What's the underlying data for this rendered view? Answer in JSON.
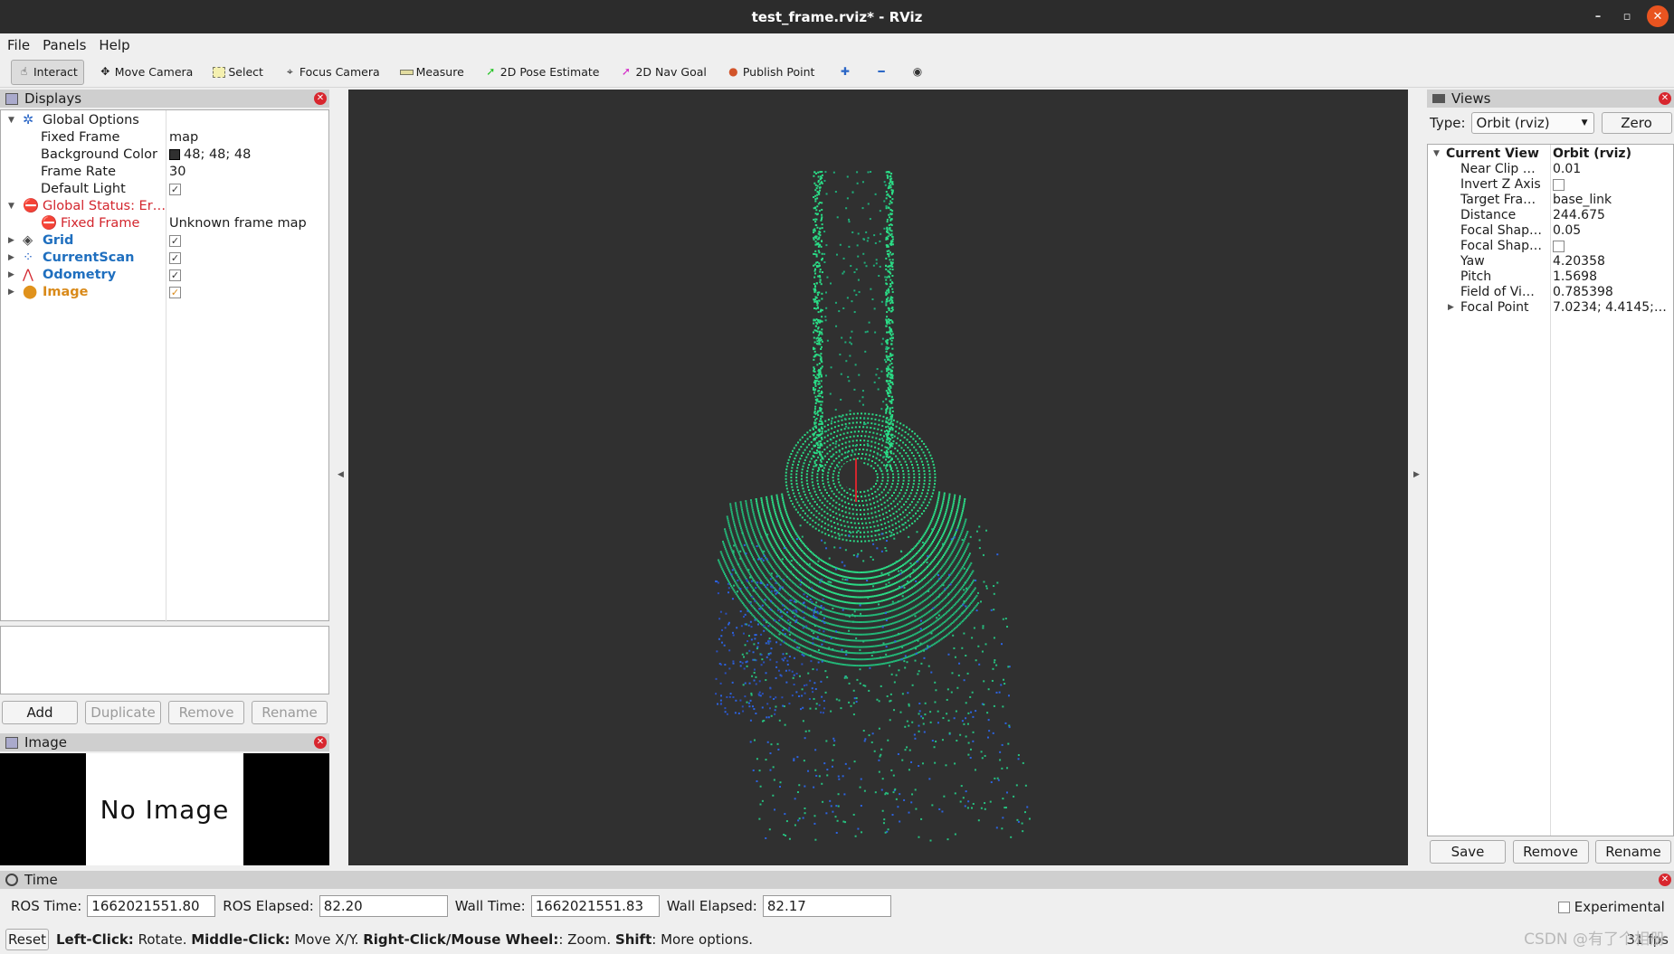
{
  "window": {
    "title": "test_frame.rviz* - RViz",
    "btn_min": "–",
    "btn_max": "▫",
    "btn_close": "✕"
  },
  "menu": [
    "File",
    "Panels",
    "Help"
  ],
  "toolbar": [
    {
      "label": "Interact",
      "icon": "hand-icon"
    },
    {
      "label": "Move Camera",
      "icon": "move-camera-icon"
    },
    {
      "label": "Select",
      "icon": "select-icon"
    },
    {
      "label": "Focus Camera",
      "icon": "focus-camera-icon"
    },
    {
      "label": "Measure",
      "icon": "measure-icon"
    },
    {
      "label": "2D Pose Estimate",
      "icon": "pose-arrow-icon"
    },
    {
      "label": "2D Nav Goal",
      "icon": "nav-goal-arrow-icon"
    },
    {
      "label": "Publish Point",
      "icon": "map-pin-icon"
    }
  ],
  "displays": {
    "title": "Displays",
    "global_options": "Global Options",
    "fixed_frame_label": "Fixed Frame",
    "fixed_frame_value": "map",
    "bg_color_label": "Background Color",
    "bg_color_value": "48; 48; 48",
    "bg_color_swatch": "#303030",
    "frame_rate_label": "Frame Rate",
    "frame_rate_value": "30",
    "default_light_label": "Default Light",
    "global_status": "Global Status: Er…",
    "status_fixed_frame": "Fixed Frame",
    "status_fixed_frame_value": "Unknown frame map",
    "grid": "Grid",
    "current_scan": "CurrentScan",
    "odometry": "Odometry",
    "image": "Image",
    "check": "✓"
  },
  "display_buttons": {
    "add": "Add",
    "duplicate": "Duplicate",
    "remove": "Remove",
    "rename": "Rename"
  },
  "image_panel": {
    "title": "Image",
    "no_image": "No Image"
  },
  "views": {
    "title": "Views",
    "type_label": "Type:",
    "type_value": "Orbit (rviz)",
    "zero": "Zero",
    "current_view": "Current View",
    "current_view_value": "Orbit (rviz)",
    "props": [
      {
        "k": "Near Clip …",
        "v": "0.01"
      },
      {
        "k": "Invert Z Axis",
        "v": ""
      },
      {
        "k": "Target Fra…",
        "v": "base_link"
      },
      {
        "k": "Distance",
        "v": "244.675"
      },
      {
        "k": "Focal Shap…",
        "v": "0.05"
      },
      {
        "k": "Focal Shap…",
        "v": ""
      },
      {
        "k": "Yaw",
        "v": "4.20358"
      },
      {
        "k": "Pitch",
        "v": "1.5698"
      },
      {
        "k": "Field of Vi…",
        "v": "0.785398"
      },
      {
        "k": "Focal Point",
        "v": "7.0234; 4.4145; -…"
      }
    ],
    "save": "Save",
    "remove": "Remove",
    "rename": "Rename"
  },
  "time": {
    "title": "Time",
    "ros_time_label": "ROS Time:",
    "ros_time": "1662021551.80",
    "ros_elapsed_label": "ROS Elapsed:",
    "ros_elapsed": "82.20",
    "wall_time_label": "Wall Time:",
    "wall_time": "1662021551.83",
    "wall_elapsed_label": "Wall Elapsed:",
    "wall_elapsed": "82.17",
    "experimental": "Experimental",
    "reset": "Reset",
    "hint_left": "Left-Click:",
    "hint_left_t": " Rotate. ",
    "hint_middle": "Middle-Click:",
    "hint_middle_t": " Move X/Y. ",
    "hint_right": "Right-Click/Mouse Wheel:",
    "hint_right_t": ": Zoom. ",
    "hint_shift": "Shift",
    "hint_shift_t": ": More options.",
    "fps": "31 fps",
    "watermark": "CSDN @有了个相册"
  },
  "colors": {
    "scan_green": "#2bdc86",
    "scan_blue": "#2c63e0",
    "error_red": "#d3262e",
    "display_blue": "#1f6fbf"
  }
}
